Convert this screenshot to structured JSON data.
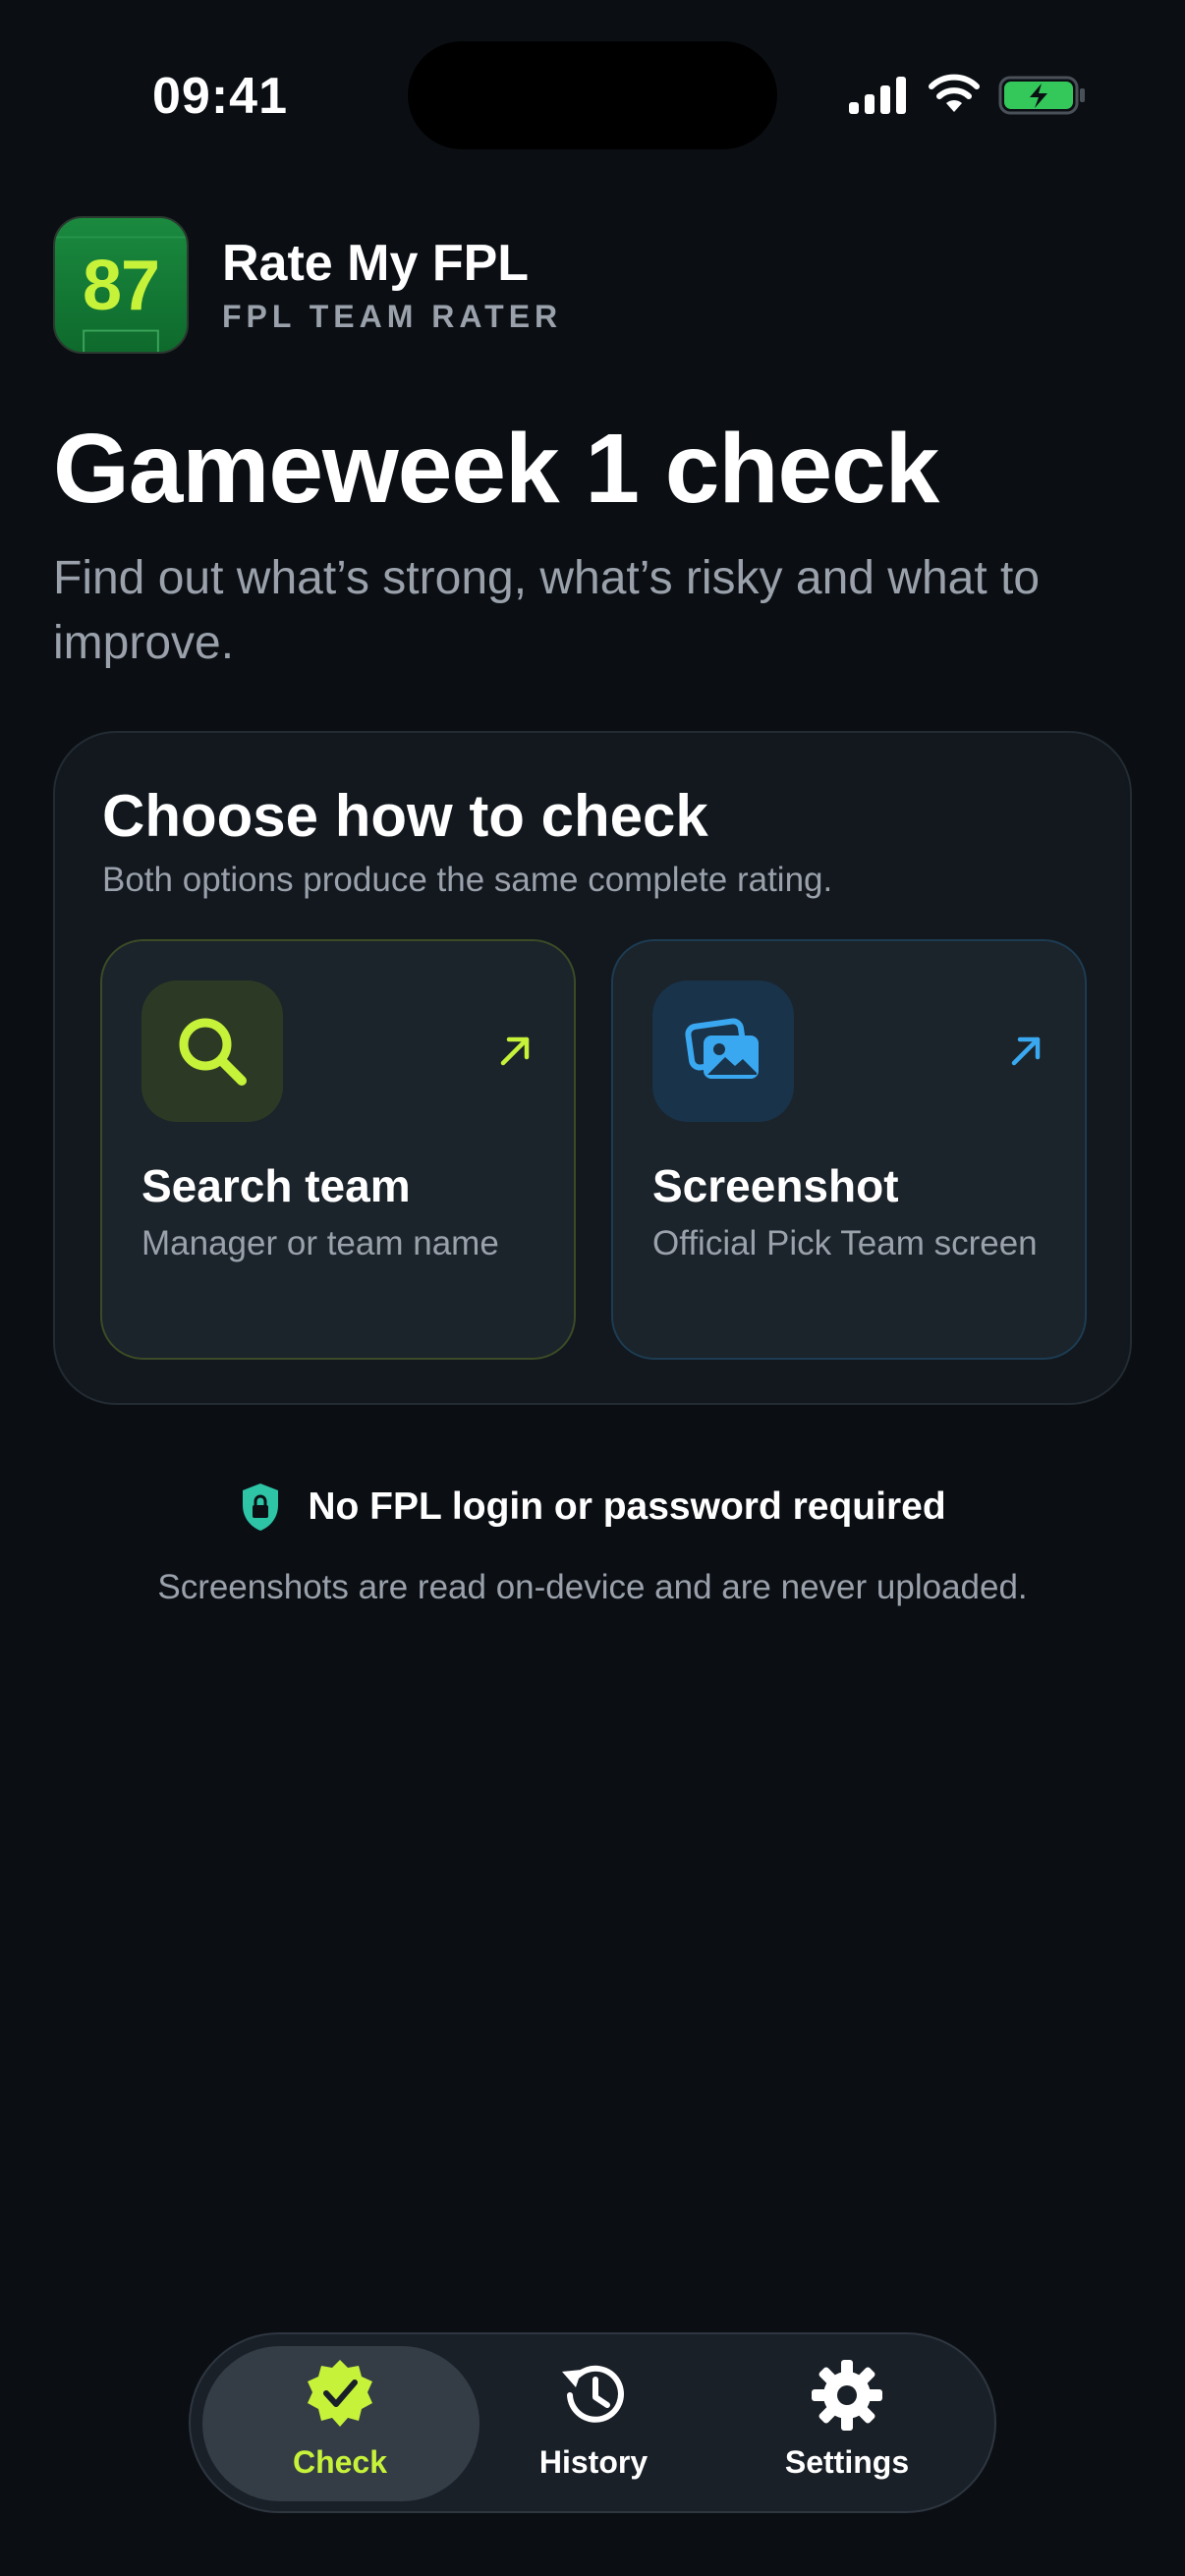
{
  "status_bar": {
    "time": "09:41"
  },
  "app": {
    "logo_score": "87",
    "title": "Rate My FPL",
    "subtitle": "FPL TEAM RATER"
  },
  "page": {
    "title": "Gameweek 1 check",
    "description": "Find out what’s strong, what’s risky and what to improve."
  },
  "choose": {
    "title": "Choose how to check",
    "subtitle": "Both options produce the same complete rating.",
    "options": [
      {
        "title": "Search team",
        "description": "Manager or team name",
        "icon": "search-icon",
        "accent": "#c6f23a"
      },
      {
        "title": "Screenshot",
        "description": "Official Pick Team screen",
        "icon": "images-icon",
        "accent": "#3aa8f0"
      }
    ]
  },
  "privacy": {
    "title": "No FPL login or password required",
    "note": "Screenshots are read on-device and are never uploaded."
  },
  "tabs": [
    {
      "label": "Check",
      "icon": "check-badge-icon",
      "active": true
    },
    {
      "label": "History",
      "icon": "history-icon",
      "active": false
    },
    {
      "label": "Settings",
      "icon": "gear-icon",
      "active": false
    }
  ],
  "colors": {
    "accent_green": "#c6f23a",
    "accent_blue": "#3aa8f0",
    "shield_teal": "#2ec4a6",
    "background": "#0b0f14"
  }
}
